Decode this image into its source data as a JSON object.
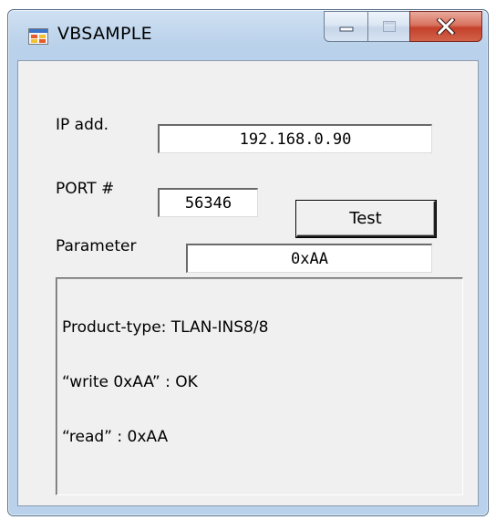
{
  "window": {
    "title": "VBSAMPLE",
    "app_icon": "windows-form-icon",
    "controls": {
      "minimize_icon": "minimize-icon",
      "maximize_icon": "maximize-icon",
      "close_icon": "close-icon"
    }
  },
  "form": {
    "ip_label": "IP add.",
    "ip_value": "192.168.0.90",
    "port_label": "PORT #",
    "port_value": "56346",
    "test_button": "Test",
    "parameter_label": "Parameter",
    "parameter_value": "0xAA",
    "output_lines": [
      "Product-type: TLAN-INS8/8",
      "“write 0xAA” : OK",
      "“read” : 0xAA"
    ]
  },
  "colors": {
    "title_bar": "#b9d1ea",
    "close_button": "#c4412b",
    "client_background": "#f0f0f0"
  }
}
